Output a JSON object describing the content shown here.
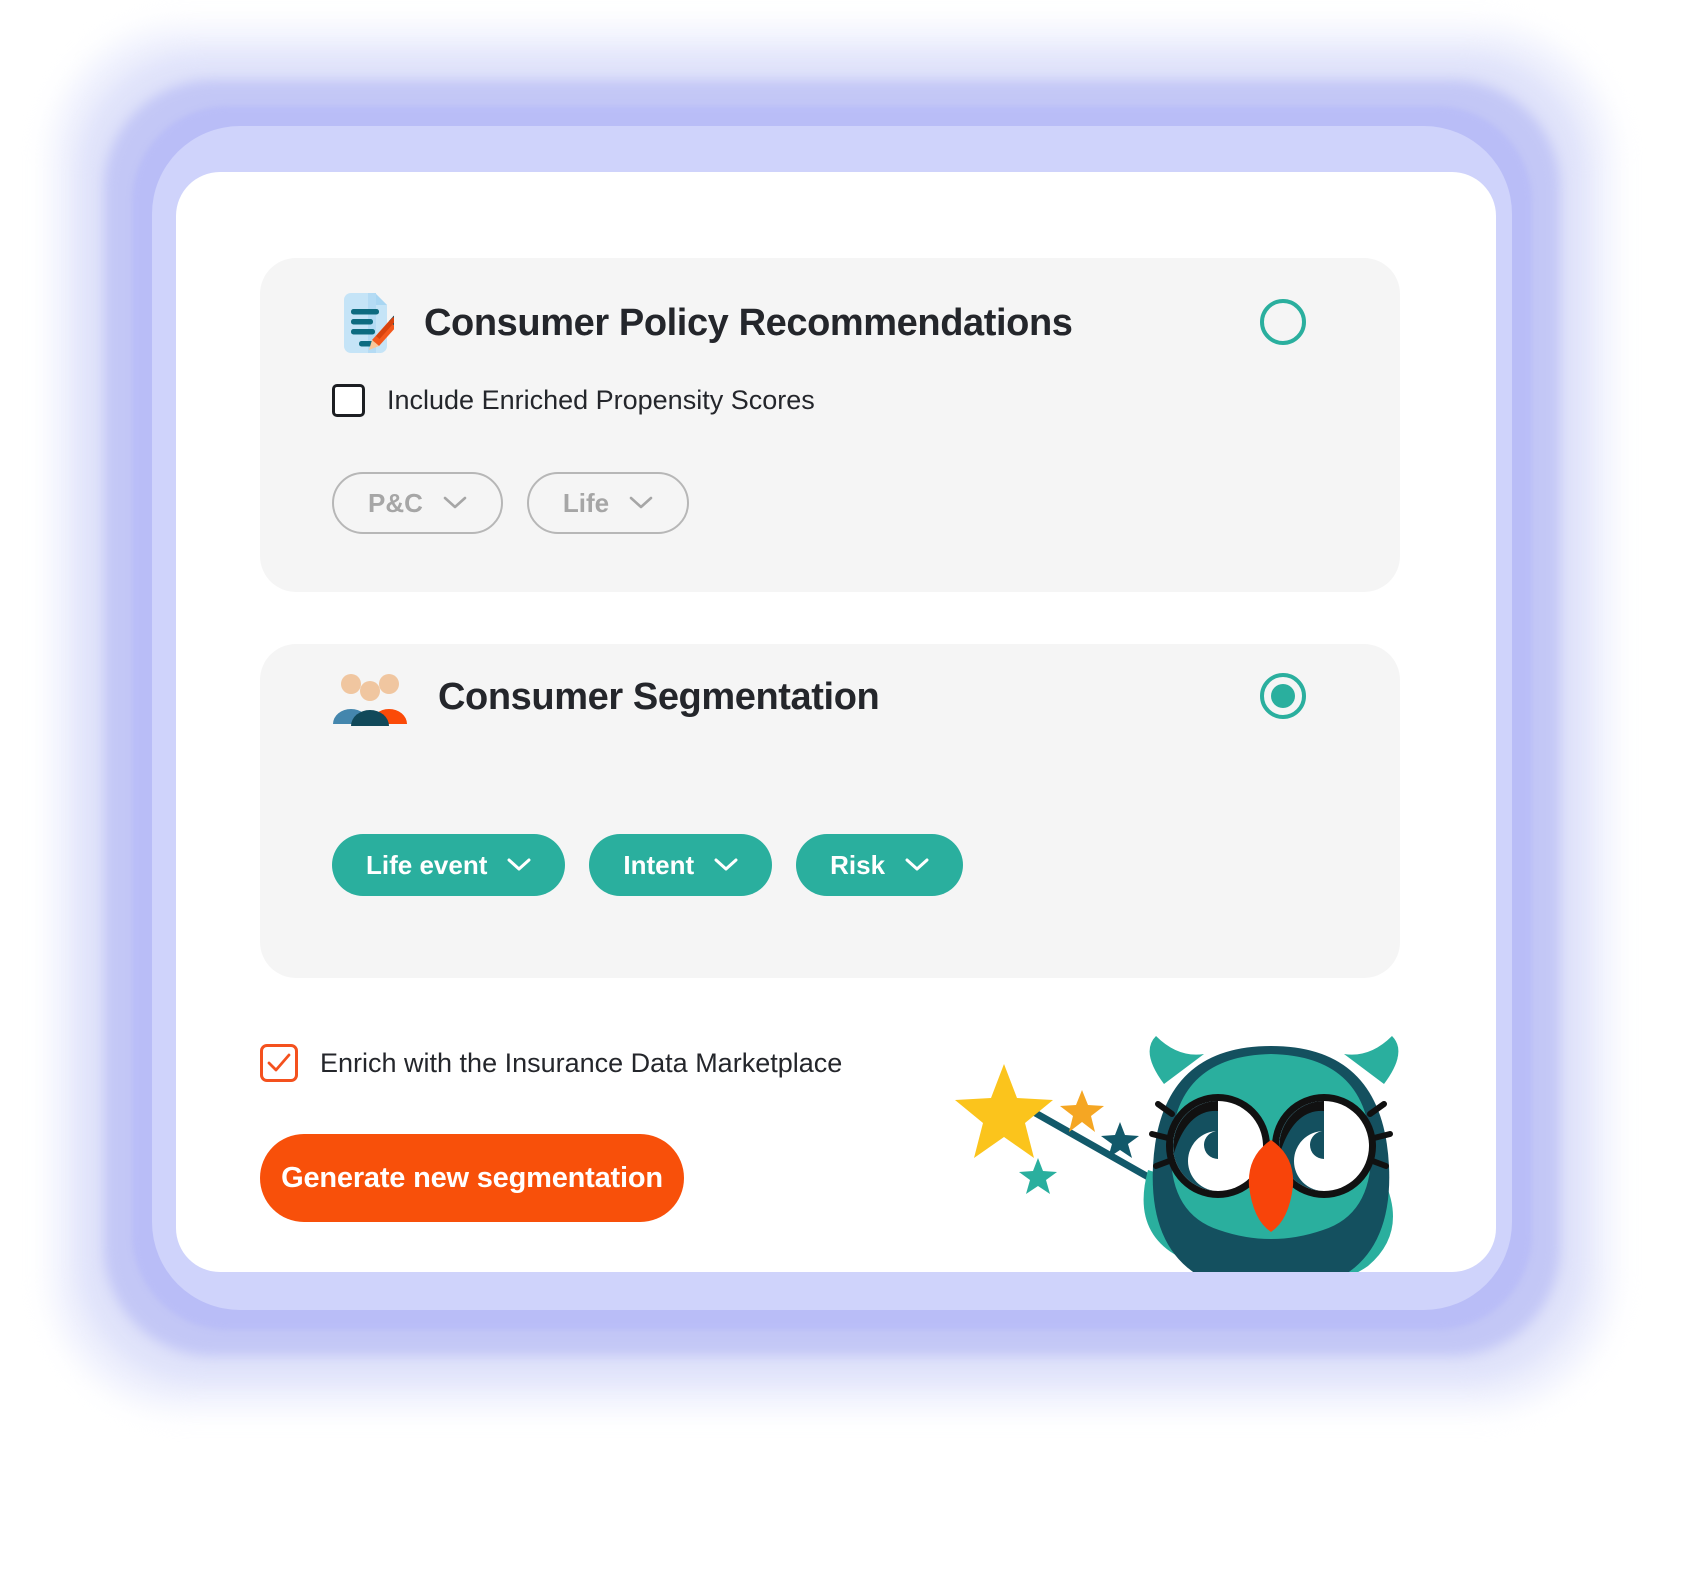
{
  "theme": {
    "accent_teal": "#2aaf9e",
    "accent_orange": "#f8500a",
    "checkbox_orange": "#f4511e",
    "panel_bg": "#ffffff",
    "card_bg": "#f5f5f5",
    "glow_periwinkle": "#b9bdf7",
    "text_dark": "#24262b",
    "muted_gray": "#a6a6a6"
  },
  "cards": [
    {
      "id": "consumer-policy-recommendations",
      "title": "Consumer Policy Recommendations",
      "icon": "document-pencil-icon",
      "selected": false,
      "checkbox": {
        "label": "Include Enriched Propensity Scores",
        "checked": false
      },
      "pills": [
        {
          "label": "P&C",
          "style": "muted",
          "icon": "chevron-down-icon"
        },
        {
          "label": "Life",
          "style": "muted",
          "icon": "chevron-down-icon"
        }
      ]
    },
    {
      "id": "consumer-segmentation",
      "title": "Consumer Segmentation",
      "icon": "people-group-icon",
      "selected": true,
      "pills": [
        {
          "label": "Life event",
          "style": "teal",
          "icon": "chevron-down-icon"
        },
        {
          "label": "Intent",
          "style": "teal",
          "icon": "chevron-down-icon"
        },
        {
          "label": "Risk",
          "style": "teal",
          "icon": "chevron-down-icon"
        }
      ]
    }
  ],
  "footer": {
    "enrich_checkbox": {
      "label": "Enrich with the Insurance Data Marketplace",
      "checked": true
    },
    "generate_button": "Generate new segmentation"
  },
  "mascot": {
    "name": "owl-with-magic-wand",
    "description": "Teal owl holding a magic wand with yellow star"
  }
}
